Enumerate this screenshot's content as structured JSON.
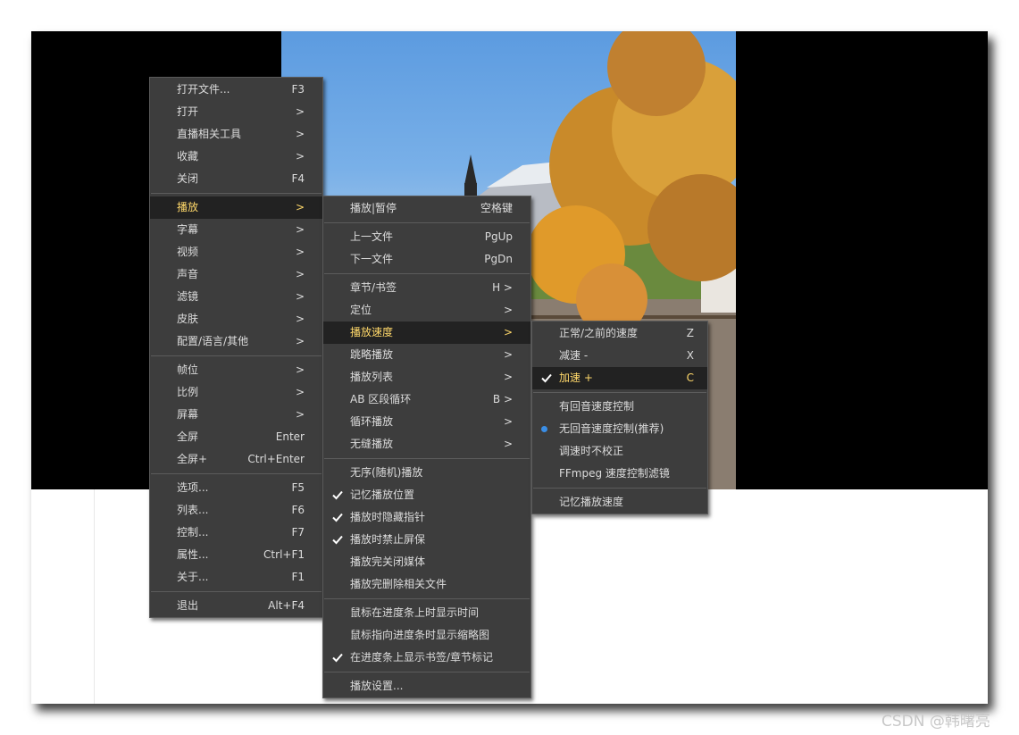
{
  "menu_main": [
    {
      "label": "打开文件...",
      "shortcut": "F3"
    },
    {
      "label": "打开",
      "shortcut": ">"
    },
    {
      "label": "直播相关工具",
      "shortcut": ">"
    },
    {
      "label": "收藏",
      "shortcut": ">"
    },
    {
      "label": "关闭",
      "shortcut": "F4"
    },
    {
      "label": "播放",
      "shortcut": ">",
      "highlighted": true
    },
    {
      "label": "字幕",
      "shortcut": ">"
    },
    {
      "label": "视频",
      "shortcut": ">"
    },
    {
      "label": "声音",
      "shortcut": ">"
    },
    {
      "label": "滤镜",
      "shortcut": ">"
    },
    {
      "label": "皮肤",
      "shortcut": ">"
    },
    {
      "label": "配置/语言/其他",
      "shortcut": ">"
    },
    {
      "label": "帧位",
      "shortcut": ">"
    },
    {
      "label": "比例",
      "shortcut": ">"
    },
    {
      "label": "屏幕",
      "shortcut": ">"
    },
    {
      "label": "全屏",
      "shortcut": "Enter"
    },
    {
      "label": "全屏+",
      "shortcut": "Ctrl+Enter"
    },
    {
      "label": "选项...",
      "shortcut": "F5"
    },
    {
      "label": "列表...",
      "shortcut": "F6"
    },
    {
      "label": "控制...",
      "shortcut": "F7"
    },
    {
      "label": "属性...",
      "shortcut": "Ctrl+F1"
    },
    {
      "label": "关于...",
      "shortcut": "F1"
    },
    {
      "label": "退出",
      "shortcut": "Alt+F4"
    }
  ],
  "menu_play": [
    {
      "label": "播放|暂停",
      "shortcut": "空格键"
    },
    {
      "label": "上一文件",
      "shortcut": "PgUp"
    },
    {
      "label": "下一文件",
      "shortcut": "PgDn"
    },
    {
      "label": "章节/书签",
      "shortcut": "H >"
    },
    {
      "label": "定位",
      "shortcut": ">"
    },
    {
      "label": "播放速度",
      "shortcut": ">",
      "highlighted": true
    },
    {
      "label": "跳略播放",
      "shortcut": ">"
    },
    {
      "label": "播放列表",
      "shortcut": ">"
    },
    {
      "label": "AB 区段循环",
      "shortcut": "B >"
    },
    {
      "label": "循环播放",
      "shortcut": ">"
    },
    {
      "label": "无缝播放",
      "shortcut": ">"
    },
    {
      "label": "无序(随机)播放",
      "shortcut": ""
    },
    {
      "label": "记忆播放位置",
      "shortcut": "",
      "checked": true
    },
    {
      "label": "播放时隐藏指针",
      "shortcut": "",
      "checked": true
    },
    {
      "label": "播放时禁止屏保",
      "shortcut": "",
      "checked": true
    },
    {
      "label": "播放完关闭媒体",
      "shortcut": ""
    },
    {
      "label": "播放完删除相关文件",
      "shortcut": ""
    },
    {
      "label": "鼠标在进度条上时显示时间",
      "shortcut": ""
    },
    {
      "label": "鼠标指向进度条时显示缩略图",
      "shortcut": ""
    },
    {
      "label": "在进度条上显示书签/章节标记",
      "shortcut": "",
      "checked": true
    },
    {
      "label": "播放设置...",
      "shortcut": ""
    }
  ],
  "menu_speed": [
    {
      "label": "正常/之前的速度",
      "shortcut": "Z"
    },
    {
      "label": "减速 -",
      "shortcut": "X"
    },
    {
      "label": "加速 +",
      "shortcut": "C",
      "checked": true,
      "highlighted": true
    },
    {
      "label": "有回音速度控制",
      "shortcut": ""
    },
    {
      "label": "无回音速度控制(推荐)",
      "shortcut": "",
      "selected": true
    },
    {
      "label": "调速时不校正",
      "shortcut": ""
    },
    {
      "label": "FFmpeg 速度控制滤镜",
      "shortcut": ""
    },
    {
      "label": "记忆播放速度",
      "shortcut": ""
    }
  ],
  "watermark": "CSDN @韩曙亮",
  "colors": {
    "menu_bg": "#3d3d3d",
    "highlight_bg": "#222222",
    "highlight_text": "#ffd86a",
    "radio": "#3a8ee6"
  }
}
